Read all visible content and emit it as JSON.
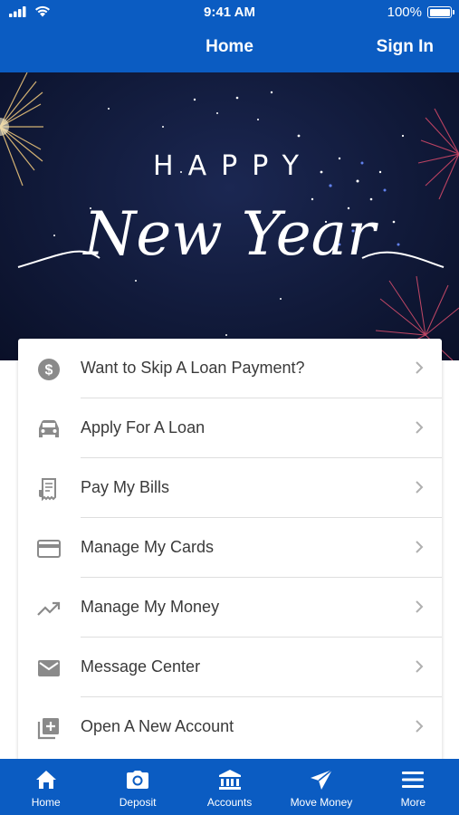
{
  "status_bar": {
    "time": "9:41 AM",
    "battery": "100%"
  },
  "header": {
    "title": "Home",
    "sign_in": "Sign In"
  },
  "banner": {
    "line1": "HAPPY",
    "line2": "New Year"
  },
  "menu": [
    {
      "label": "Want to Skip A Loan Payment?",
      "icon": "dollar-circle-icon"
    },
    {
      "label": "Apply For A Loan",
      "icon": "car-icon"
    },
    {
      "label": "Pay My Bills",
      "icon": "receipt-icon"
    },
    {
      "label": "Manage My Cards",
      "icon": "credit-card-icon"
    },
    {
      "label": "Manage My Money",
      "icon": "trending-up-icon"
    },
    {
      "label": "Message Center",
      "icon": "envelope-icon"
    },
    {
      "label": "Open A New Account",
      "icon": "add-box-icon"
    }
  ],
  "tabs": [
    {
      "label": "Home",
      "icon": "home-icon"
    },
    {
      "label": "Deposit",
      "icon": "camera-icon"
    },
    {
      "label": "Accounts",
      "icon": "bank-icon"
    },
    {
      "label": "Move Money",
      "icon": "paper-plane-icon"
    },
    {
      "label": "More",
      "icon": "hamburger-icon"
    }
  ],
  "colors": {
    "brand_blue": "#0b5cc2",
    "icon_gray": "#8a8a8a",
    "text": "#3a3a3a"
  }
}
